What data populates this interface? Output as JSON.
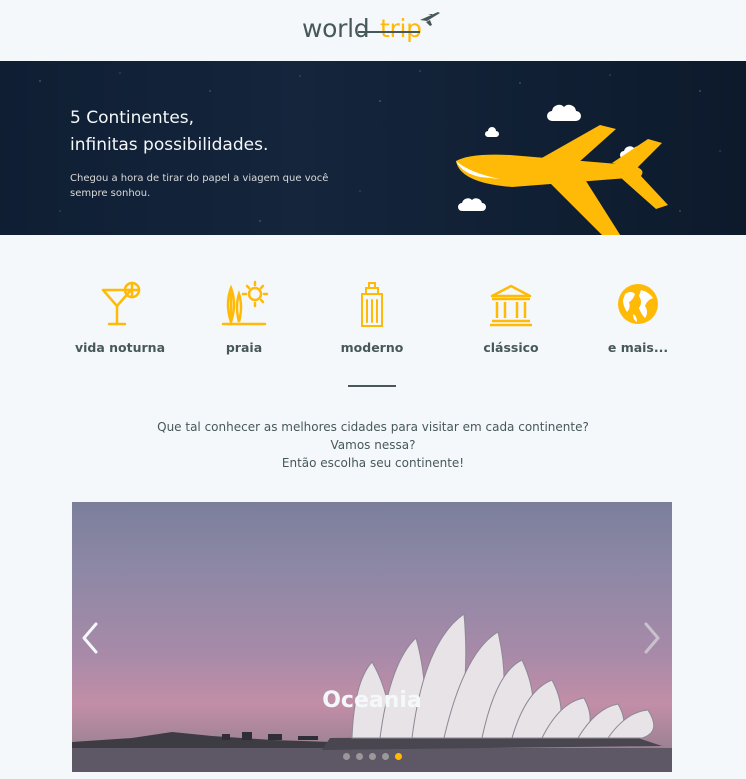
{
  "logo": {
    "part1": "world",
    "part2": "trip"
  },
  "banner": {
    "title_line1": "5 Continentes,",
    "title_line2": "infinitas possibilidades.",
    "subtitle": "Chegou a hora de tirar do papel a viagem que você sempre sonhou."
  },
  "categories": [
    {
      "label": "vida noturna",
      "icon": "cocktail-icon"
    },
    {
      "label": "praia",
      "icon": "surfboard-icon"
    },
    {
      "label": "moderno",
      "icon": "building-icon"
    },
    {
      "label": "clássico",
      "icon": "museum-icon"
    },
    {
      "label": "e mais...",
      "icon": "globe-icon"
    }
  ],
  "intro": {
    "line1": "Que tal conhecer as melhores cidades para visitar em cada continente?",
    "line2": "Vamos nessa?",
    "line3": "Então escolha seu continente!"
  },
  "slider": {
    "title": "Oceania",
    "dots": 5,
    "active_dot": 5
  },
  "colors": {
    "accent": "#ffba08",
    "text": "#47585b",
    "background": "#f5f8fa",
    "banner": "#14253c"
  }
}
